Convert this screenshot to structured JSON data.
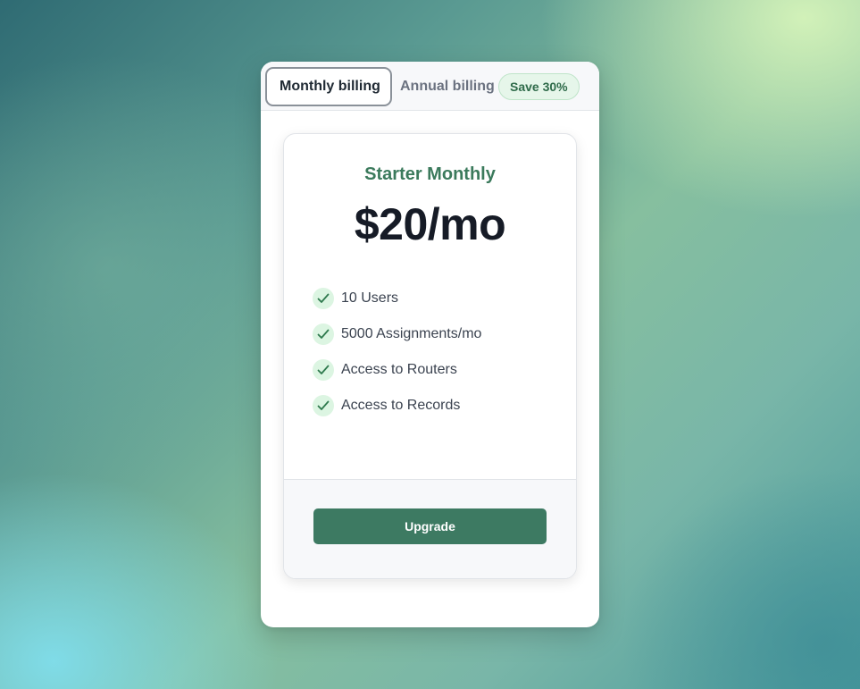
{
  "colors": {
    "accent": "#3d7a62",
    "plan_name": "#3b7a5c",
    "badge_bg": "#e6f6ea",
    "badge_text": "#2f6b4a",
    "check_bg": "#dcf5e2"
  },
  "billing_tabs": {
    "monthly_label": "Monthly billing",
    "annual_label": "Annual billing",
    "save_badge": "Save 30%",
    "selected": "Monthly billing"
  },
  "plan": {
    "name": "Starter Monthly",
    "price": "$20/mo",
    "features": [
      {
        "icon": "check-icon",
        "label": "10 Users"
      },
      {
        "icon": "check-icon",
        "label": "5000 Assignments/mo"
      },
      {
        "icon": "check-icon",
        "label": "Access to Routers"
      },
      {
        "icon": "check-icon",
        "label": "Access to Records"
      }
    ],
    "cta_label": "Upgrade"
  }
}
